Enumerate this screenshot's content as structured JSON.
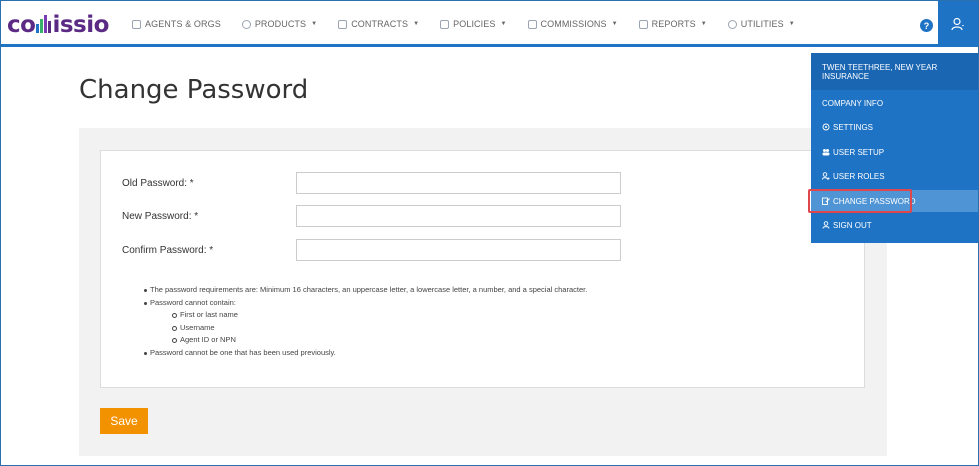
{
  "logo": {
    "text_left": "co",
    "text_right": "issio"
  },
  "nav": {
    "items": [
      {
        "label": "AGENTS & ORGS",
        "icon": "agents-icon",
        "dropdown": false
      },
      {
        "label": "PRODUCTS",
        "icon": "products-icon",
        "dropdown": true
      },
      {
        "label": "CONTRACTS",
        "icon": "contracts-icon",
        "dropdown": true
      },
      {
        "label": "POLICIES",
        "icon": "policies-icon",
        "dropdown": true
      },
      {
        "label": "COMMISSIONS",
        "icon": "commissions-icon",
        "dropdown": true
      },
      {
        "label": "REPORTS",
        "icon": "reports-icon",
        "dropdown": true
      },
      {
        "label": "UTILITIES",
        "icon": "utilities-icon",
        "dropdown": true
      }
    ],
    "help_label": "?"
  },
  "page": {
    "title": "Change Password"
  },
  "form": {
    "old_password_label": "Old Password: *",
    "new_password_label": "New Password: *",
    "confirm_password_label": "Confirm Password: *",
    "old_password_value": "",
    "new_password_value": "",
    "confirm_password_value": ""
  },
  "requirements": {
    "item1": "The password requirements are: Minimum 16 characters, an uppercase letter, a lowercase letter, a number, and a special character.",
    "item2": "Password cannot contain:",
    "sub1": "First or last name",
    "sub2": "Username",
    "sub3": "Agent ID or NPN",
    "item3": "Password cannot be one that has been used previously."
  },
  "save_label": "Save",
  "user_menu": {
    "header": "TWEN TEETHREE, NEW YEAR INSURANCE",
    "items": [
      {
        "label": "COMPANY INFO",
        "icon": ""
      },
      {
        "label": "SETTINGS",
        "icon": "gear-icon"
      },
      {
        "label": "USER SETUP",
        "icon": "users-icon"
      },
      {
        "label": "USER ROLES",
        "icon": "user-roles-icon"
      },
      {
        "label": "CHANGE PASSWORD",
        "icon": "edit-icon"
      },
      {
        "label": "SIGN OUT",
        "icon": "user-icon"
      }
    ],
    "active_item": "CHANGE PASSWORD"
  },
  "colors": {
    "brand_blue": "#1f73c4",
    "logo_purple": "#5a2a85",
    "save_orange": "#f39200",
    "highlight_red": "#e0474c"
  }
}
